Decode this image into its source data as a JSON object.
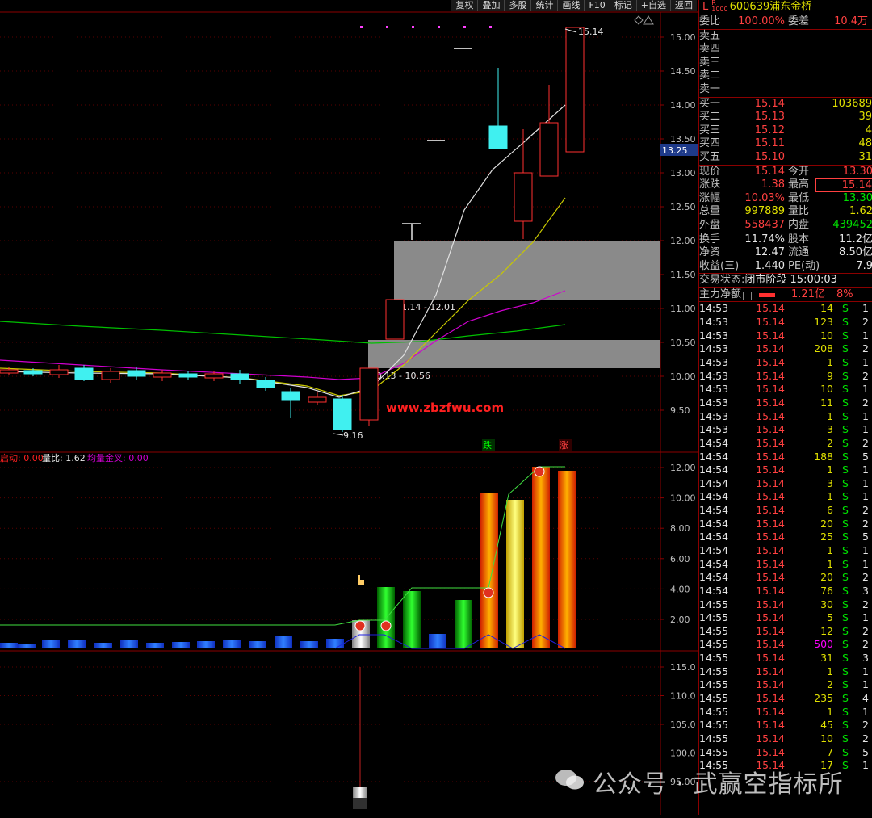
{
  "toolbar": [
    "复权",
    "叠加",
    "多股",
    "统计",
    "画线",
    "F10",
    "标记",
    "+自选",
    "返回"
  ],
  "price_axis": [
    "15.00",
    "14.50",
    "14.00",
    "13.50",
    "13.00",
    "12.50",
    "12.00",
    "11.50",
    "11.00",
    "10.50",
    "10.00",
    "9.50"
  ],
  "current_price_tag": "13.25",
  "annotations": {
    "high": "15.14",
    "low": "9.16",
    "zone_upper": "11.14 - 12.01",
    "zone_lower": "10.13 - 10.56"
  },
  "site_watermark": "www.zbzfwu.com",
  "signals": {
    "die": "跌",
    "zhang": "涨"
  },
  "vol_panel": {
    "label1": "启动: 0.00",
    "label2": "量比: 1.62",
    "label3": "均量金叉: 0.00",
    "axis": [
      "12.00",
      "10.00",
      "8.00",
      "6.00",
      "4.00",
      "2.00"
    ]
  },
  "ind_panel": {
    "axis": [
      "115.0",
      "110.0",
      "105.0",
      "100.0",
      "95.00"
    ]
  },
  "quote": {
    "head_L": "L",
    "head_R": "R",
    "head_sub": "1000",
    "code": "600639",
    "name": "浦东金桥",
    "weibi_label": "委比",
    "weibi": "100.00%",
    "weicha_label": "委差",
    "weicha": "10.4万",
    "sell": [
      {
        "label": "卖五"
      },
      {
        "label": "卖四"
      },
      {
        "label": "卖三"
      },
      {
        "label": "卖二"
      },
      {
        "label": "卖一"
      }
    ],
    "buy": [
      {
        "label": "买一",
        "price": "15.14",
        "vol": "103689"
      },
      {
        "label": "买二",
        "price": "15.13",
        "vol": "39"
      },
      {
        "label": "买三",
        "price": "15.12",
        "vol": "4"
      },
      {
        "label": "买四",
        "price": "15.11",
        "vol": "48"
      },
      {
        "label": "买五",
        "price": "15.10",
        "vol": "31"
      }
    ],
    "stats": [
      {
        "l1": "现价",
        "v1": "15.14",
        "l2": "今开",
        "v2": "13.30"
      },
      {
        "l1": "涨跌",
        "v1": "1.38",
        "l2": "最高",
        "v2": "15.14"
      },
      {
        "l1": "涨幅",
        "v1": "10.03%",
        "l2": "最低",
        "v2": "13.30"
      },
      {
        "l1": "总量",
        "v1": "997889",
        "l2": "量比",
        "v2": "1.62"
      },
      {
        "l1": "外盘",
        "v1": "558437",
        "l2": "内盘",
        "v2": "439452"
      }
    ],
    "stats2": [
      {
        "l1": "换手",
        "v1": "11.74%",
        "l2": "股本",
        "v2": "11.2亿"
      },
      {
        "l1": "净资",
        "v1": "12.47",
        "l2": "流通",
        "v2": "8.50亿"
      },
      {
        "l1": "收益(三)",
        "v1": "1.440",
        "l2": "PE(动)",
        "v2": "7.9"
      }
    ],
    "trade_state_label": "交易状态:",
    "trade_state": "闭市阶段 15:00:03",
    "main_label": "主力净额",
    "main_val": "1.21亿",
    "main_pct": "8%"
  },
  "ticks": [
    {
      "t": "14:53",
      "p": "15.14",
      "v": "14",
      "s": "S",
      "n": "1"
    },
    {
      "t": "14:53",
      "p": "15.14",
      "v": "123",
      "s": "S",
      "n": "2"
    },
    {
      "t": "14:53",
      "p": "15.14",
      "v": "10",
      "s": "S",
      "n": "1"
    },
    {
      "t": "14:53",
      "p": "15.14",
      "v": "208",
      "s": "S",
      "n": "2"
    },
    {
      "t": "14:53",
      "p": "15.14",
      "v": "1",
      "s": "S",
      "n": "1"
    },
    {
      "t": "14:53",
      "p": "15.14",
      "v": "9",
      "s": "S",
      "n": "2"
    },
    {
      "t": "14:53",
      "p": "15.14",
      "v": "10",
      "s": "S",
      "n": "1"
    },
    {
      "t": "14:53",
      "p": "15.14",
      "v": "11",
      "s": "S",
      "n": "2"
    },
    {
      "t": "14:53",
      "p": "15.14",
      "v": "1",
      "s": "S",
      "n": "1"
    },
    {
      "t": "14:53",
      "p": "15.14",
      "v": "3",
      "s": "S",
      "n": "1"
    },
    {
      "t": "14:54",
      "p": "15.14",
      "v": "2",
      "s": "S",
      "n": "2"
    },
    {
      "t": "14:54",
      "p": "15.14",
      "v": "188",
      "s": "S",
      "n": "5"
    },
    {
      "t": "14:54",
      "p": "15.14",
      "v": "1",
      "s": "S",
      "n": "1"
    },
    {
      "t": "14:54",
      "p": "15.14",
      "v": "3",
      "s": "S",
      "n": "1"
    },
    {
      "t": "14:54",
      "p": "15.14",
      "v": "1",
      "s": "S",
      "n": "1"
    },
    {
      "t": "14:54",
      "p": "15.14",
      "v": "6",
      "s": "S",
      "n": "2"
    },
    {
      "t": "14:54",
      "p": "15.14",
      "v": "20",
      "s": "S",
      "n": "2"
    },
    {
      "t": "14:54",
      "p": "15.14",
      "v": "25",
      "s": "S",
      "n": "5"
    },
    {
      "t": "14:54",
      "p": "15.14",
      "v": "1",
      "s": "S",
      "n": "1"
    },
    {
      "t": "14:54",
      "p": "15.14",
      "v": "1",
      "s": "S",
      "n": "1"
    },
    {
      "t": "14:54",
      "p": "15.14",
      "v": "20",
      "s": "S",
      "n": "2"
    },
    {
      "t": "14:54",
      "p": "15.14",
      "v": "76",
      "s": "S",
      "n": "3"
    },
    {
      "t": "14:55",
      "p": "15.14",
      "v": "30",
      "s": "S",
      "n": "2"
    },
    {
      "t": "14:55",
      "p": "15.14",
      "v": "5",
      "s": "S",
      "n": "1"
    },
    {
      "t": "14:55",
      "p": "15.14",
      "v": "12",
      "s": "S",
      "n": "2"
    },
    {
      "t": "14:55",
      "p": "15.14",
      "v": "500",
      "s": "S",
      "n": "2"
    },
    {
      "t": "14:55",
      "p": "15.14",
      "v": "31",
      "s": "S",
      "n": "3"
    },
    {
      "t": "14:55",
      "p": "15.14",
      "v": "1",
      "s": "S",
      "n": "1"
    },
    {
      "t": "14:55",
      "p": "15.14",
      "v": "2",
      "s": "S",
      "n": "1"
    },
    {
      "t": "14:55",
      "p": "15.14",
      "v": "235",
      "s": "S",
      "n": "4"
    },
    {
      "t": "14:55",
      "p": "15.14",
      "v": "1",
      "s": "S",
      "n": "1"
    },
    {
      "t": "14:55",
      "p": "15.14",
      "v": "45",
      "s": "S",
      "n": "2"
    },
    {
      "t": "14:55",
      "p": "15.14",
      "v": "10",
      "s": "S",
      "n": "2"
    },
    {
      "t": "14:55",
      "p": "15.14",
      "v": "7",
      "s": "S",
      "n": "5"
    },
    {
      "t": "14:55",
      "p": "15.14",
      "v": "17",
      "s": "S",
      "n": "1"
    }
  ],
  "article_watermark": "公众号 · 武赢空指标所"
}
